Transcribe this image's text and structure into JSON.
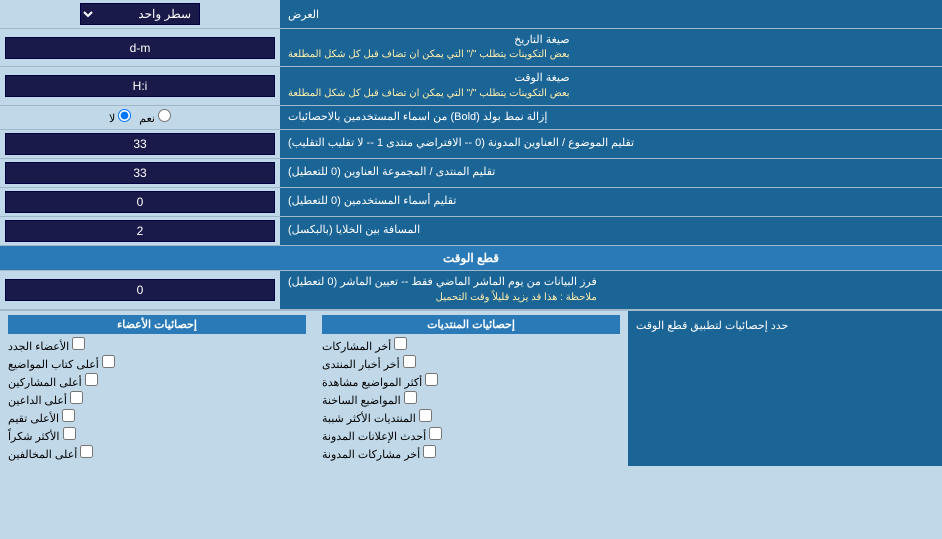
{
  "header": {
    "display_label": "العرض",
    "display_value": "سطر واحد"
  },
  "rows": [
    {
      "id": "date-format",
      "label1": "صيغة التاريخ",
      "label2": "بعض التكوينات يتطلب \"/\" التي يمكن ان تضاف قبل كل شكل المطلعة",
      "value": "d-m"
    },
    {
      "id": "time-format",
      "label1": "صيغة الوقت",
      "label2": "بعض التكوينات يتطلب \"/\" التي يمكن ان تضاف قبل كل شكل المطلعة",
      "value": "H:i"
    },
    {
      "id": "bold-remove",
      "label1": "إزالة نمط بولد (Bold) من اسماء المستخدمين بالاحصائيات",
      "radio_yes": "نعم",
      "radio_no": "لا",
      "radio_default": "no"
    },
    {
      "id": "topics-count",
      "label1": "تقليم الموضوع / العناوين المدونة (0 -- الافتراضي منتدى 1 -- لا تقليب التقليب)",
      "value": "33"
    },
    {
      "id": "forum-group",
      "label1": "تقليم المنتدى / المجموعة العناوين (0 للتعطيل)",
      "value": "33"
    },
    {
      "id": "users-count",
      "label1": "تقليم أسماء المستخدمين (0 للتعطيل)",
      "value": "0"
    },
    {
      "id": "spacing",
      "label1": "المسافة بين الخلايا (بالبكسل)",
      "value": "2"
    }
  ],
  "time_cut": {
    "section_title": "قطع الوقت",
    "row": {
      "label1": "فرز البيانات من يوم الماشر الماضي فقط -- تعيين الماشر (0 لتعطيل)",
      "label2_note": "ملاحظة : هذا قد يزيد قليلاً وقت التحميل",
      "value": "0"
    }
  },
  "stats_limit_label": "حدد إحصائيات لتطبيق قطع الوقت",
  "checkboxes": {
    "col1_header": "إحصائيات المنتديات",
    "col1_items": [
      "أخر المشاركات",
      "أخر أخبار المنتدى",
      "أكثر المواضيع مشاهدة",
      "المواضيع الساخنة",
      "المنتديات الأكثر شببة",
      "أحدث الإعلانات المدونة",
      "أخر مشاركات المدونة"
    ],
    "col2_header": "إحصائيات الأعضاء",
    "col2_items": [
      "الأعضاء الجدد",
      "أعلى كتاب المواضيع",
      "أعلى المشاركين",
      "أعلى الداعين",
      "الأعلى تقيم",
      "الأكثر شكراً",
      "أعلى المخالفين"
    ]
  }
}
